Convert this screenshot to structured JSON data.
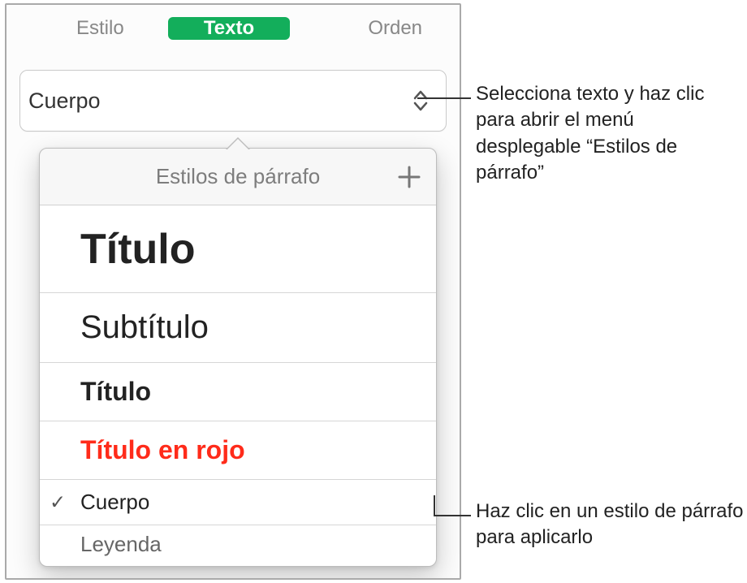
{
  "tabs": {
    "style": "Estilo",
    "text": "Texto",
    "order": "Orden"
  },
  "style_popup": {
    "current": "Cuerpo"
  },
  "dropdown": {
    "title": "Estilos de párrafo",
    "items": {
      "titulo_grande": "Título",
      "subtitulo": "Subtítulo",
      "titulo": "Título",
      "titulo_rojo": "Título en rojo",
      "cuerpo": "Cuerpo",
      "leyenda": "Leyenda"
    },
    "checkmark": "✓"
  },
  "callouts": {
    "c1": "Selecciona texto y haz clic para abrir el menú desplegable “Estilos de párrafo”",
    "c2": "Haz clic en un estilo de párrafo para aplicarlo"
  }
}
